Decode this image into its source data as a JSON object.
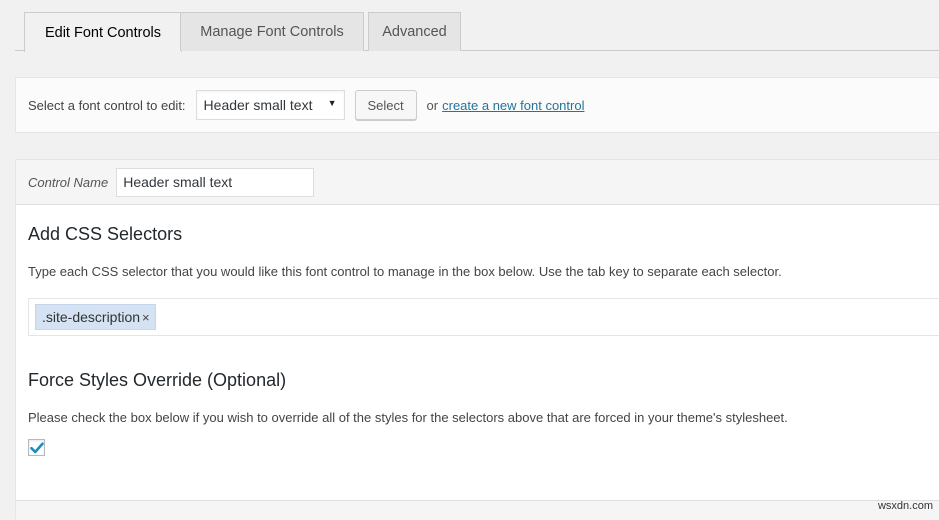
{
  "tabs": [
    {
      "label": "Edit Font Controls",
      "active": true
    },
    {
      "label": "Manage Font Controls",
      "active": false
    },
    {
      "label": "Advanced",
      "active": false
    }
  ],
  "select_bar": {
    "label": "Select a font control to edit:",
    "selected_option": "Header small text",
    "caret_icon": "▼",
    "select_button": "Select",
    "or_text": "or",
    "create_link": "create a new font control"
  },
  "control": {
    "name_label": "Control Name",
    "name_value": "Header small text"
  },
  "css_selectors": {
    "title": "Add CSS Selectors",
    "description": "Type each CSS selector that you would like this font control to manage in the box below. Use the tab key to separate each selector.",
    "tags": [
      {
        "label": ".site-description",
        "remove_icon": "×"
      }
    ]
  },
  "force_override": {
    "title": "Force Styles Override (Optional)",
    "description": "Please check the box below if you wish to override all of the styles for the selectors above that are forced in your theme's stylesheet.",
    "checked": true
  },
  "colors": {
    "accent": "#1e8cbe",
    "link": "#21759b",
    "tag_bg": "#d4e2f3"
  },
  "watermark": "wsxdn.com"
}
